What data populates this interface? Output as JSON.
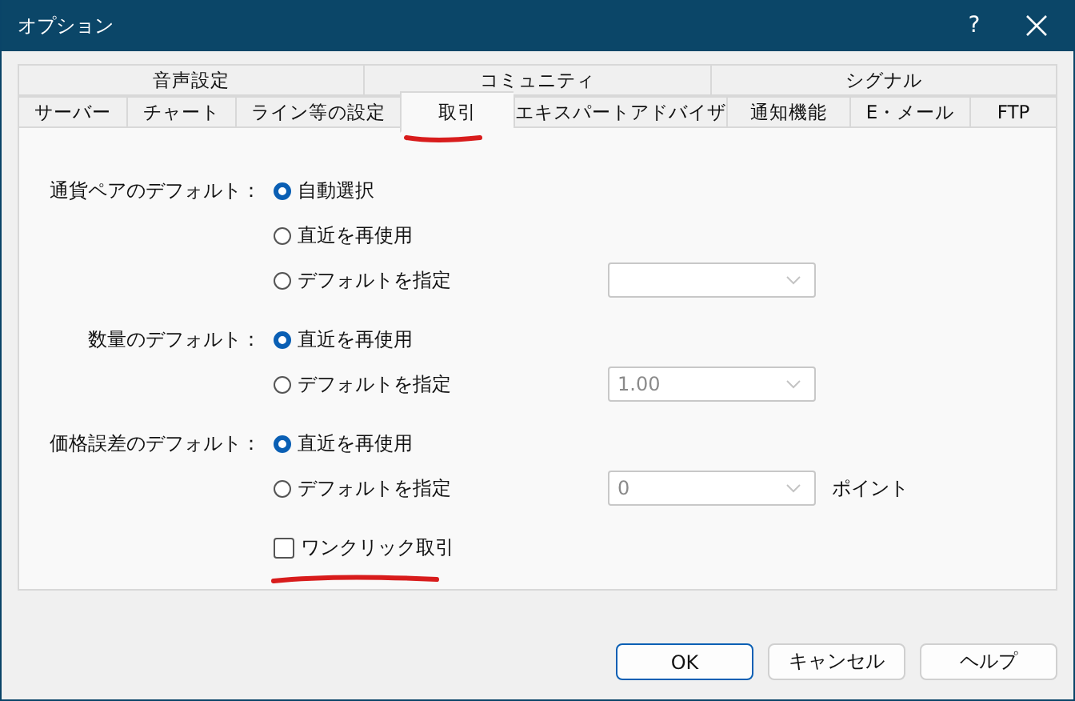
{
  "window": {
    "title": "オプション",
    "help_button": "?"
  },
  "tab_rows": [
    [
      {
        "label": "音声設定",
        "selected": false
      },
      {
        "label": "コミュニティ",
        "selected": false
      },
      {
        "label": "シグナル",
        "selected": false
      }
    ],
    [
      {
        "label": "サーバー",
        "selected": false
      },
      {
        "label": "チャート",
        "selected": false
      },
      {
        "label": "ライン等の設定",
        "selected": false
      },
      {
        "label": "取引",
        "selected": true
      },
      {
        "label": "エキスパートアドバイザ",
        "selected": false
      },
      {
        "label": "通知機能",
        "selected": false
      },
      {
        "label": "E・メール",
        "selected": false
      },
      {
        "label": "FTP",
        "selected": false
      }
    ]
  ],
  "groups": [
    {
      "label": "通貨ペアのデフォルト：",
      "options": [
        {
          "label": "自動選択",
          "selected": true
        },
        {
          "label": "直近を再使用",
          "selected": false
        },
        {
          "label": "デフォルトを指定",
          "selected": false
        }
      ],
      "dropdown": {
        "disabled": true
      }
    },
    {
      "label": "数量のデフォルト：",
      "options": [
        {
          "label": "直近を再使用",
          "selected": true
        },
        {
          "label": "デフォルトを指定",
          "selected": false
        }
      ],
      "dropdown": {
        "value": "1.00",
        "disabled": true
      }
    },
    {
      "label": "価格誤差のデフォルト：",
      "options": [
        {
          "label": "直近を再使用",
          "selected": true
        },
        {
          "label": "デフォルトを指定",
          "selected": false
        }
      ],
      "dropdown": {
        "value": "0",
        "disabled": true
      },
      "unit": "ポイント"
    }
  ],
  "one_click": {
    "label": "ワンクリック取引",
    "checked": false
  },
  "buttons": [
    {
      "label": "OK",
      "focused": true
    },
    {
      "label": "キャンセル",
      "focused": false
    },
    {
      "label": "ヘルプ",
      "focused": false
    }
  ]
}
